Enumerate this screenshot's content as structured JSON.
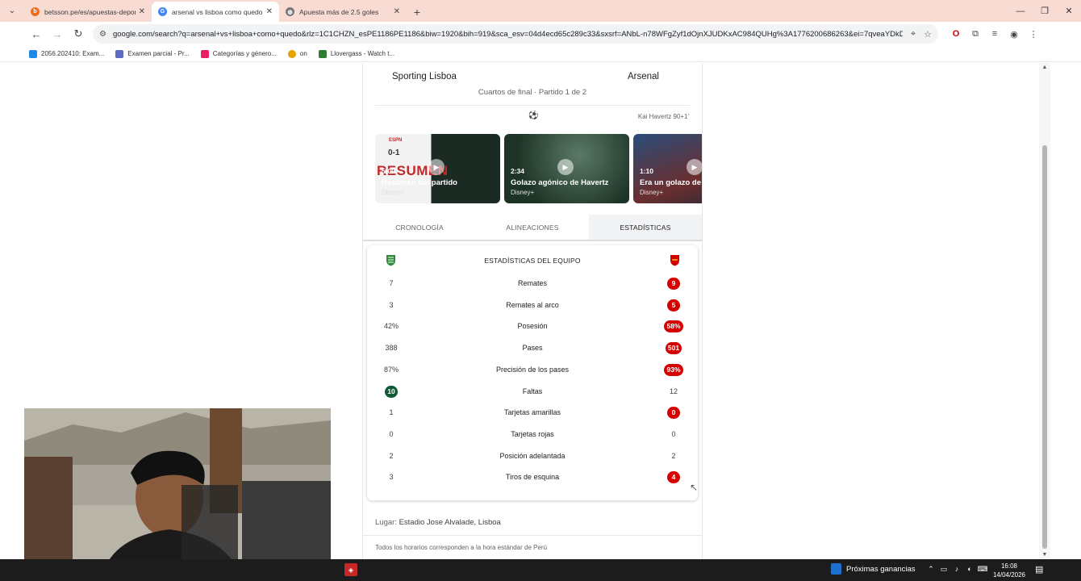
{
  "browser": {
    "tabs": [
      {
        "title": "betsson.pe/es/apuestas-deport",
        "favicon_color": "#f26b1d",
        "active": false
      },
      {
        "title": "arsenal vs lisboa como quedo",
        "favicon_color": "#4285f4",
        "active": true
      },
      {
        "title": "Apuesta más de 2.5 goles",
        "favicon_color": "#777777",
        "active": false
      }
    ],
    "url": "google.com/search?q=arsenal+vs+lisboa+como+quedo&rlz=1C1CHZN_esPE1186PE1186&biw=1920&bih=919&sca_esv=04d4ecd65c289c33&sxsrf=ANbL-n78WFgZyf1dOjnXJUDKxAC984QUHg%3A1776200686263&ei=7qveaYDkD_Hc1s...",
    "bookmarks": [
      {
        "label": "2056.202410: Exam...",
        "color": "#1e88e5"
      },
      {
        "label": "Examen parcial - Pr...",
        "color": "#5c6bc0"
      },
      {
        "label": "Categorías y género...",
        "color": "#e91e63"
      },
      {
        "label": "on",
        "color": "#333333"
      },
      {
        "label": "Llovergass - Watch t...",
        "color": "#2e7d32"
      }
    ]
  },
  "match": {
    "home_team": "Sporting Lisboa",
    "away_team": "Arsenal",
    "stage": "Cuartos de final · Partido 1 de 2",
    "goal_scorer": "Kai Havertz 90+1'",
    "ball_icon": "⚽"
  },
  "videos": [
    {
      "duration": "5:00",
      "title": "Resumen del partido",
      "source": "Disney+",
      "brand": "ESPN",
      "score": "0-1",
      "overlay": "RESUMEN",
      "bg": "#1b2a22"
    },
    {
      "duration": "2:34",
      "title": "Golazo agónico de Havertz",
      "source": "Disney+",
      "bg": "#2e4a3a"
    },
    {
      "duration": "1:10",
      "title": "Era un golazo de Z",
      "source": "Disney+",
      "bg": "#33405a"
    }
  ],
  "stat_tabs": [
    "CRONOLOGÍA",
    "ALINEACIONES",
    "ESTADÍSTICAS"
  ],
  "stats_title": "ESTADÍSTICAS DEL EQUIPO",
  "stats": [
    {
      "label": "Remates",
      "home": "7",
      "away": "9",
      "highlight": "away"
    },
    {
      "label": "Remates al arco",
      "home": "3",
      "away": "5",
      "highlight": "away"
    },
    {
      "label": "Posesión",
      "home": "42%",
      "away": "58%",
      "highlight": "away"
    },
    {
      "label": "Pases",
      "home": "388",
      "away": "501",
      "highlight": "away"
    },
    {
      "label": "Precisión de los pases",
      "home": "87%",
      "away": "93%",
      "highlight": "away"
    },
    {
      "label": "Faltas",
      "home": "10",
      "away": "12",
      "highlight": "home"
    },
    {
      "label": "Tarjetas amarillas",
      "home": "1",
      "away": "0",
      "highlight": "away"
    },
    {
      "label": "Tarjetas rojas",
      "home": "0",
      "away": "0",
      "highlight": "none"
    },
    {
      "label": "Posición adelantada",
      "home": "2",
      "away": "2",
      "highlight": "none"
    },
    {
      "label": "Tiros de esquina",
      "home": "3",
      "away": "4",
      "highlight": "away"
    }
  ],
  "venue": {
    "label": "Lugar:",
    "value": "Estadio Jose Alvalade, Lisboa"
  },
  "timezone_note": "Todos los horarios corresponden a la hora estándar de Perú",
  "taskbar": {
    "news": "Próximas ganancias",
    "time": "16:08",
    "date": "14/04/2026"
  },
  "colors": {
    "home_green": "#0d5a34",
    "away_red": "#d50000"
  }
}
